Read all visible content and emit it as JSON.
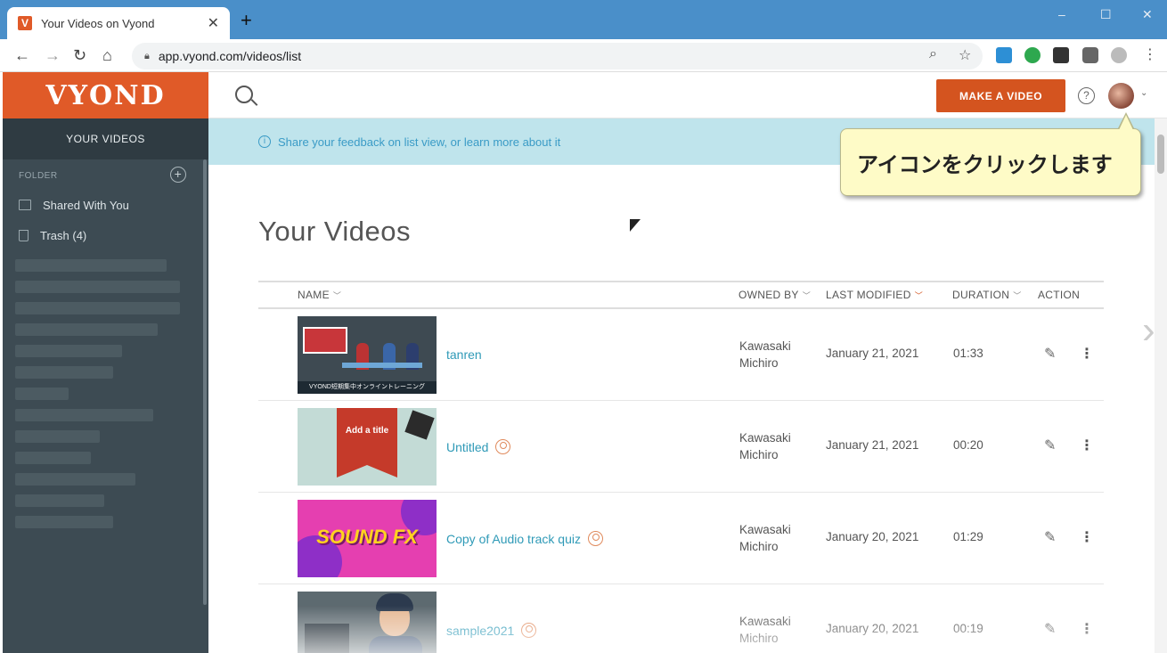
{
  "browser": {
    "tab_title": "Your Videos on Vyond",
    "tab_favicon": "V",
    "new_tab": "+",
    "url": "app.vyond.com/videos/list",
    "window_controls": [
      "–",
      "☐",
      "✕"
    ]
  },
  "sidebar": {
    "logo": "VYOND",
    "active_section": "YOUR VIDEOS",
    "folder_header": "FOLDER",
    "folder_add": "+",
    "items": [
      {
        "label": "Shared With You",
        "icon": "shared-folder-icon"
      },
      {
        "label": "Trash (4)",
        "icon": "trash-icon"
      }
    ]
  },
  "topbar": {
    "make_video_label": "MAKE A VIDEO",
    "help_label": "?"
  },
  "banner": {
    "info_icon": "i",
    "text": "Share your feedback on list view, or learn more about it"
  },
  "callout": {
    "text": "アイコンをクリックします"
  },
  "main": {
    "title": "Your Videos",
    "columns": {
      "name": "NAME",
      "owned_by": "OWNED BY",
      "last_modified": "LAST MODIFIED",
      "duration": "DURATION",
      "action": "ACTION"
    },
    "rows": [
      {
        "name": "tanren",
        "owner_first": "Kawasaki",
        "owner_last": "Michiro",
        "modified": "January 21, 2021",
        "duration": "01:33",
        "shared": false,
        "thumb_caption": "VYOND短期集中オンライントレーニング"
      },
      {
        "name": "Untitled",
        "owner_first": "Kawasaki",
        "owner_last": "Michiro",
        "modified": "January 21, 2021",
        "duration": "00:20",
        "shared": true,
        "thumb_caption": "Add a title"
      },
      {
        "name": "Copy of Audio track quiz",
        "owner_first": "Kawasaki",
        "owner_last": "Michiro",
        "modified": "January 20, 2021",
        "duration": "01:29",
        "shared": true,
        "thumb_caption": "SOUND FX"
      },
      {
        "name": "sample2021",
        "owner_first": "Kawasaki",
        "owner_last": "Michiro",
        "modified": "January 20, 2021",
        "duration": "00:19",
        "shared": true,
        "thumb_caption": ""
      }
    ]
  },
  "colors": {
    "brand_orange": "#d4541f",
    "link_teal": "#2f9ab7",
    "sidebar_bg": "#3d4b53",
    "banner_bg": "#bfe4ec"
  }
}
